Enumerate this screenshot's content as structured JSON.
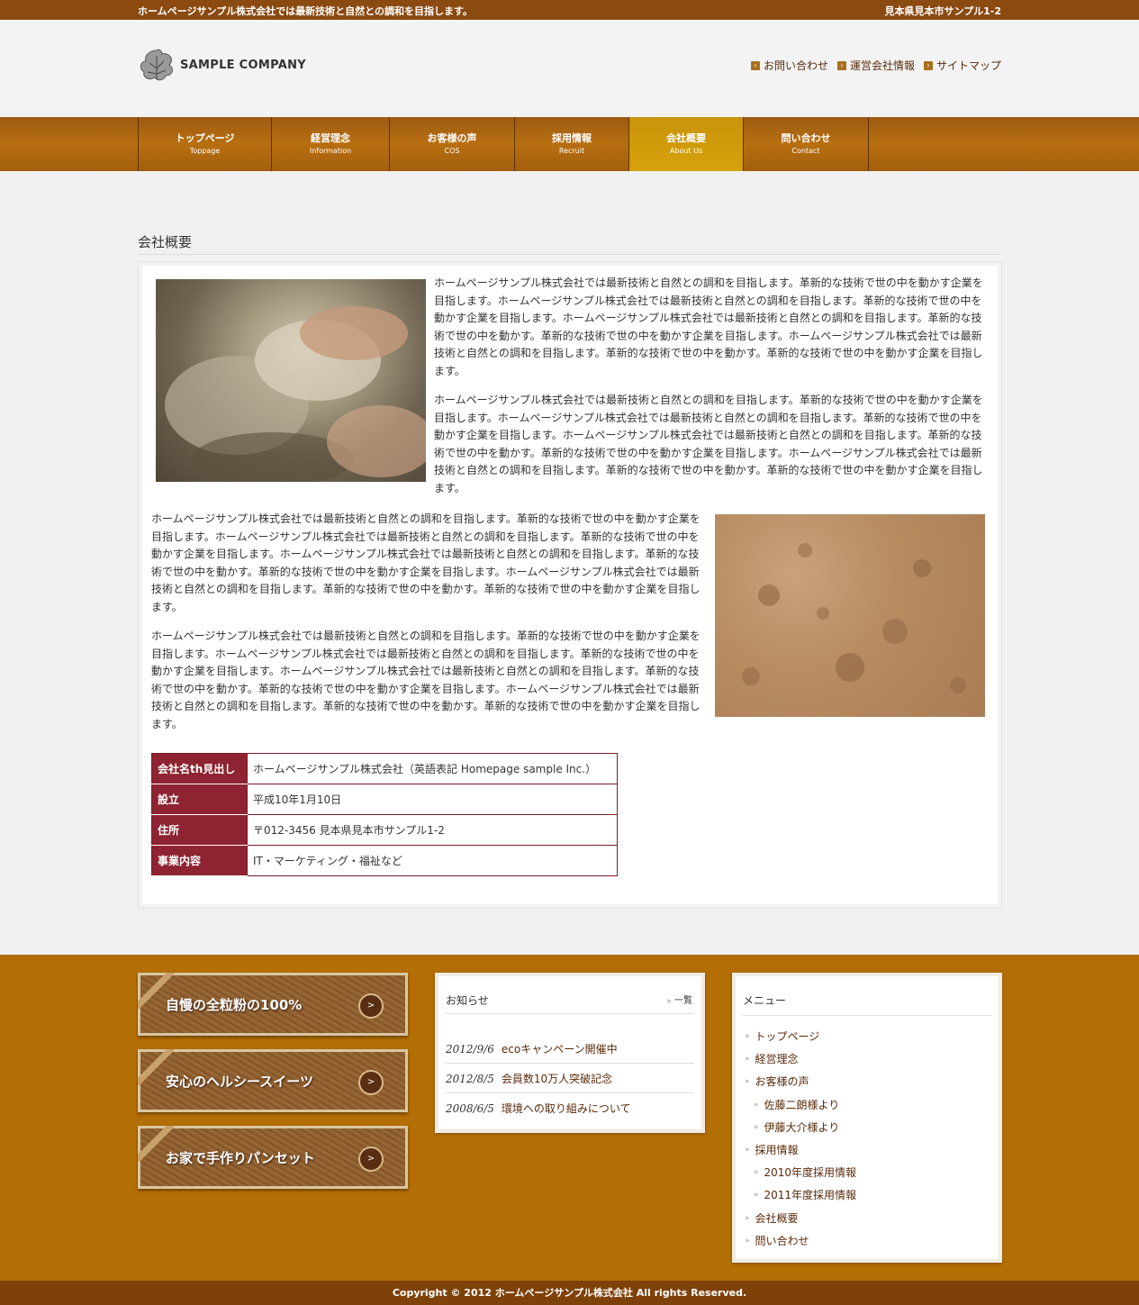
{
  "topbar": {
    "tagline": "ホームページサンプル株式会社では最新技術と自然との調和を目指します。",
    "address": "見本県見本市サンプル1-2"
  },
  "header": {
    "logo_text": "SAMPLE COMPANY",
    "links": [
      "お問い合わせ",
      "運営会社情報",
      "サイトマップ"
    ]
  },
  "nav": [
    {
      "jp": "トップページ",
      "en": "Toppage"
    },
    {
      "jp": "経営理念",
      "en": "Information"
    },
    {
      "jp": "お客様の声",
      "en": "COS"
    },
    {
      "jp": "採用情報",
      "en": "Recruit"
    },
    {
      "jp": "会社概要",
      "en": "About Us"
    },
    {
      "jp": "問い合わせ",
      "en": "Contact"
    }
  ],
  "nav_active": "About Us",
  "main": {
    "page_title": "会社概要",
    "paragraph": "ホームページサンプル株式会社では最新技術と自然との調和を目指します。革新的な技術で世の中を動かす企業を目指します。ホームページサンプル株式会社では最新技術と自然との調和を目指します。革新的な技術で世の中を動かす企業を目指します。ホームページサンプル株式会社では最新技術と自然との調和を目指します。革新的な技術で世の中を動かす。革新的な技術で世の中を動かす企業を目指します。ホームページサンプル株式会社では最新技術と自然との調和を目指します。革新的な技術で世の中を動かす。革新的な技術で世の中を動かす企業を目指します。",
    "table": [
      {
        "th": "会社名th見出し",
        "td": "ホームページサンプル株式会社（英語表記 Homepage sample Inc.）"
      },
      {
        "th": "設立",
        "td": "平成10年1月10日"
      },
      {
        "th": "住所",
        "td": "〒012-3456 見本県見本市サンプル1-2"
      },
      {
        "th": "事業内容",
        "td": "IT・マーケティング・福祉など"
      }
    ]
  },
  "footer": {
    "banners": [
      "自慢の全粒粉の100%",
      "安心のヘルシースイーツ",
      "お家で手作りパンセット"
    ],
    "banner_button": ">",
    "news": {
      "heading": "お知らせ",
      "more": "一覧",
      "items": [
        {
          "date": "2012/9/6",
          "title": "ecoキャンペーン開催中"
        },
        {
          "date": "2012/8/5",
          "title": "会員数10万人突破記念"
        },
        {
          "date": "2008/6/5",
          "title": "環境への取り組みについて"
        }
      ]
    },
    "menu": {
      "heading": "メニュー",
      "items": [
        {
          "label": "トップページ",
          "level": 0
        },
        {
          "label": "経営理念",
          "level": 0
        },
        {
          "label": "お客様の声",
          "level": 0
        },
        {
          "label": "佐藤二朗様より",
          "level": 1
        },
        {
          "label": "伊藤大介様より",
          "level": 1
        },
        {
          "label": "採用情報",
          "level": 0
        },
        {
          "label": "2010年度採用情報",
          "level": 1
        },
        {
          "label": "2011年度採用情報",
          "level": 1
        },
        {
          "label": "会社概要",
          "level": 0
        },
        {
          "label": "問い合わせ",
          "level": 0
        }
      ]
    },
    "copyright": "Copyright © 2012 ホームページサンプル株式会社 All rights Reserved."
  },
  "colors": {
    "brand_brown": "#8a4a10",
    "nav_active": "#d6a20a",
    "table_header": "#8e2331",
    "footer_bg": "#b36e05"
  }
}
